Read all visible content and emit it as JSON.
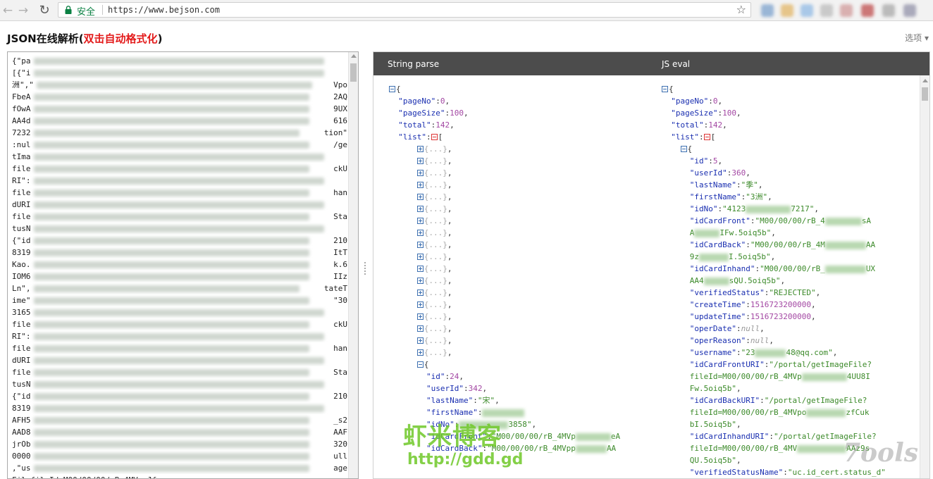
{
  "browser": {
    "secure_label": "安全",
    "url": "https://www.bejson.com"
  },
  "page": {
    "title_main": "JSON在线解析(",
    "title_highlight": "双击自动格式化",
    "title_close": ")",
    "options_label": "选项"
  },
  "raw_editor": {
    "lines": [
      "{\"pa",
      "[{\"i",
      "洲\",\"",
      "FbeA",
      "fOwA",
      "AA4d",
      "7232",
      ":nul",
      "tIma",
      "file",
      "RI\":",
      "file",
      "dURI",
      "file",
      "tusN",
      "{\"id",
      "8319",
      "Kao.",
      "IOM6",
      "Ln\",",
      "ime\"",
      "3165",
      "file",
      "RI\":",
      "file",
      "dURI",
      "file",
      "tusN",
      "{\"id",
      "8319",
      "AFH5",
      "AAD8",
      "jrOb",
      "0000",
      ",\"us",
      "FilefileId=M00/00/00/rB_4MVpaJf"
    ],
    "line_ends": [
      "",
      "",
      "Vpo",
      "2AQ",
      "9UX",
      "616",
      "tion\"",
      "/ge",
      "",
      "ckU",
      "",
      "han",
      "",
      "Sta",
      "",
      "210",
      "ItT",
      "k.6",
      "IIz",
      "tateT",
      "\"30",
      "",
      "ckU",
      "",
      "han",
      "",
      "Sta",
      "",
      "210",
      "",
      "_s2",
      "AAF",
      "320",
      "ull",
      "age",
      ""
    ]
  },
  "view": {
    "tab_string": "String parse",
    "tab_eval": "JS eval",
    "left": {
      "pageNo_key": "\"pageNo\"",
      "pageNo_val": "0",
      "pageSize_key": "\"pageSize\"",
      "pageSize_val": "100",
      "total_key": "\"total\"",
      "total_val": "142",
      "list_key": "\"list\"",
      "collapsed": "{...}",
      "collapsed_count": 18,
      "item": {
        "id_key": "\"id\"",
        "id_val": "24",
        "userId_key": "\"userId\"",
        "userId_val": "342",
        "lastName_key": "\"lastName\"",
        "lastName_val": "\"宋\"",
        "firstName_key": "\"firstName\"",
        "idNo_key": "\"idNo\"",
        "idNo_tail": "3858\"",
        "idCardFront_key": "\"idCardFront\"",
        "idCardFront_val": "\"M00/00/00/rB_4MVp",
        "idCardFront_tail": "eA",
        "idCardBack_key": "\"idCardBack\"",
        "idCardBack_val": "\"M00/00/00/rB_4MVpp",
        "idCardBack_tail": "AA"
      }
    },
    "right": {
      "id_val": "5",
      "userId_val": "360",
      "lastName_val": "\"季\"",
      "firstName_val_a": "\"3",
      "firstName_val_b": "洲\"",
      "idNo_a": "\"4123",
      "idNo_b": "7217\"",
      "idCardFront_a": "\"M00/00/00/rB_4",
      "idCardFront_b": "sA",
      "idCardFront_c": "A",
      "idCardFront_d": "IFw.5oiq5b\"",
      "idCardBack_a": "\"M00/00/00/rB_4M",
      "idCardBack_b": "AA",
      "idCardBack_c": "9z",
      "idCardBack_d": "I.5oiq5b\"",
      "idCardInhand_a": "\"M00/00/00/rB_",
      "idCardInhand_b": "UX",
      "idCardInhand_c": "AA4",
      "idCardInhand_d": "sQU.5oiq5b\"",
      "verifiedStatus_val": "\"REJECTED\"",
      "createTime_val": "1516723200000",
      "updateTime_val": "1516723200000",
      "operDate_val": "null",
      "operReason_val": "null",
      "username_a": "\"23",
      "username_b": "48@qq.com\"",
      "front_uri_val": "\"/portal/getImageFile?",
      "front_uri_2a": "fileId=M00/00/00/rB_4MVp",
      "front_uri_2b": "4UU8I",
      "front_uri_3": "Fw.5oiq5b\"",
      "back_uri_val": "\"/portal/getImageFile?",
      "back_uri_2a": "fileId=M00/00/00/rB_4MVpo",
      "back_uri_2b": "zfCuk",
      "back_uri_3": "bI.5oiq5b\"",
      "inhand_uri_val": "\"/portal/getImageFile?",
      "inhand_uri_2a": "fileId=M00/00/00/rB_4MV",
      "inhand_uri_2b": "AAz9s",
      "inhand_uri_3": "QU.5oiq5b\"",
      "vsn_val": "\"uc.id_cert.status_d\""
    }
  },
  "watermarks": {
    "cn": "虾米博客",
    "url": "http://gdd.gd",
    "tools": "7ools"
  }
}
